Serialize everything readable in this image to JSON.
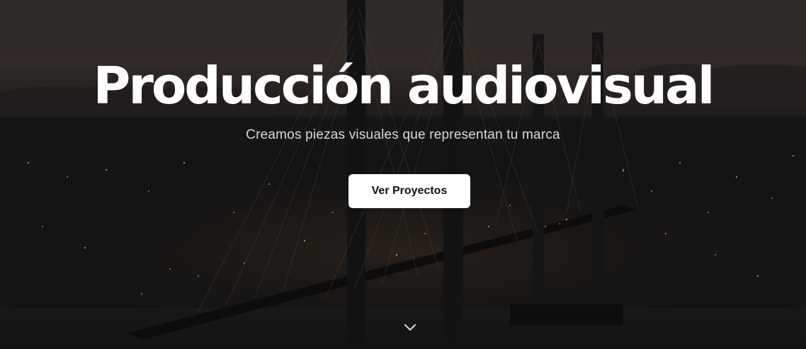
{
  "hero": {
    "title": "Producción audiovisual",
    "subtitle": "Creamos piezas visuales que representan tu marca",
    "cta_label": "Ver Proyectos",
    "background_icon": "night-cable-bridge-city-photo",
    "scroll_icon": "chevron-down-icon"
  },
  "colors": {
    "title": "#ffffff",
    "subtitle": "#d9d9dc",
    "button_bg": "#ffffff",
    "button_text": "#111111"
  }
}
